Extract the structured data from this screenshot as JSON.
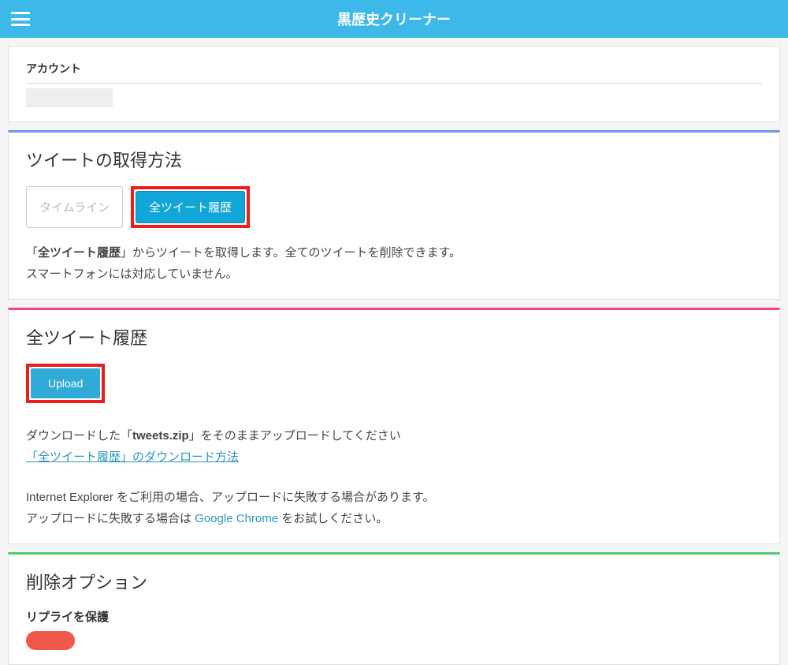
{
  "header": {
    "title": "黒歴史クリーナー"
  },
  "account": {
    "label": "アカウント"
  },
  "fetchMethod": {
    "title": "ツイートの取得方法",
    "tabs": {
      "timeline": "タイムライン",
      "allHistory": "全ツイート履歴"
    },
    "desc1_prefix": "「",
    "desc1_bold": "全ツイート履歴",
    "desc1_suffix": "」からツイートを取得します。全てのツイートを削除できます。",
    "desc2": "スマートフォンには対応していません。"
  },
  "allHistory": {
    "title": "全ツイート履歴",
    "uploadLabel": "Upload",
    "uploadDesc_prefix": "ダウンロードした「",
    "uploadDesc_filename": "tweets.zip",
    "uploadDesc_suffix": "」をそのままアップロードしてください",
    "downloadLink": "「全ツイート履歴」のダウンロード方法",
    "ieNote": "Internet Explorer をご利用の場合、アップロードに失敗する場合があります。",
    "chromeNote_prefix": "アップロードに失敗する場合は ",
    "chromeNote_link": "Google Chrome",
    "chromeNote_suffix": " をお試しください。"
  },
  "deleteOptions": {
    "title": "削除オプション",
    "protectReplies": "リプライを保護"
  }
}
